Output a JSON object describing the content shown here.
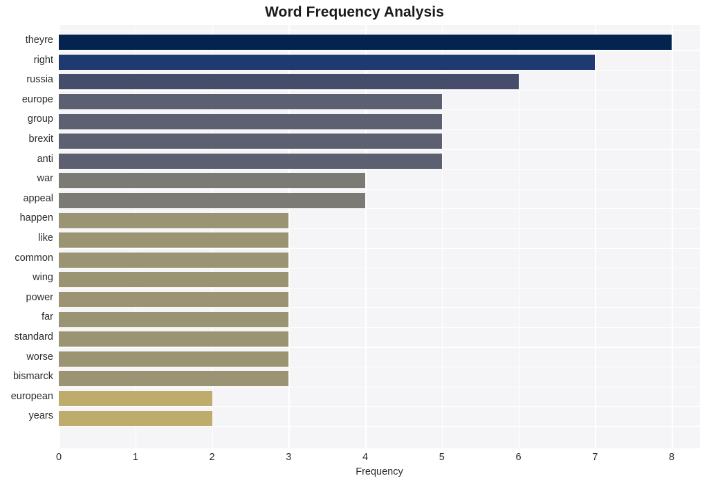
{
  "chart_data": {
    "type": "bar",
    "orientation": "horizontal",
    "title": "Word Frequency Analysis",
    "xlabel": "Frequency",
    "ylabel": "",
    "xlim": [
      0,
      8
    ],
    "xticks": [
      "0",
      "1",
      "2",
      "3",
      "4",
      "5",
      "6",
      "7",
      "8"
    ],
    "grid": true,
    "legend": null,
    "categories": [
      "theyre",
      "right",
      "russia",
      "europe",
      "group",
      "brexit",
      "anti",
      "war",
      "appeal",
      "happen",
      "like",
      "common",
      "wing",
      "power",
      "far",
      "standard",
      "worse",
      "bismarck",
      "european",
      "years"
    ],
    "values": [
      8,
      7,
      6,
      5,
      5,
      5,
      5,
      4,
      4,
      3,
      3,
      3,
      3,
      3,
      3,
      3,
      3,
      3,
      2,
      2
    ],
    "bar_colors": [
      "#04244f",
      "#1e3a70",
      "#454d6b",
      "#5c6070",
      "#5c6070",
      "#5c6070",
      "#5c6070",
      "#7b7a75",
      "#7b7a75",
      "#9b9472",
      "#9b9472",
      "#9b9472",
      "#9b9472",
      "#9b9472",
      "#9b9472",
      "#9b9472",
      "#9b9472",
      "#9b9472",
      "#bdac6b",
      "#bdac6b"
    ]
  },
  "style": {
    "plot_background": "#f5f5f7",
    "figure_background": "#ffffff",
    "gridline_color": "#ffffff",
    "text_color": "#2b2b2b",
    "title_color": "#1a1a1a"
  }
}
